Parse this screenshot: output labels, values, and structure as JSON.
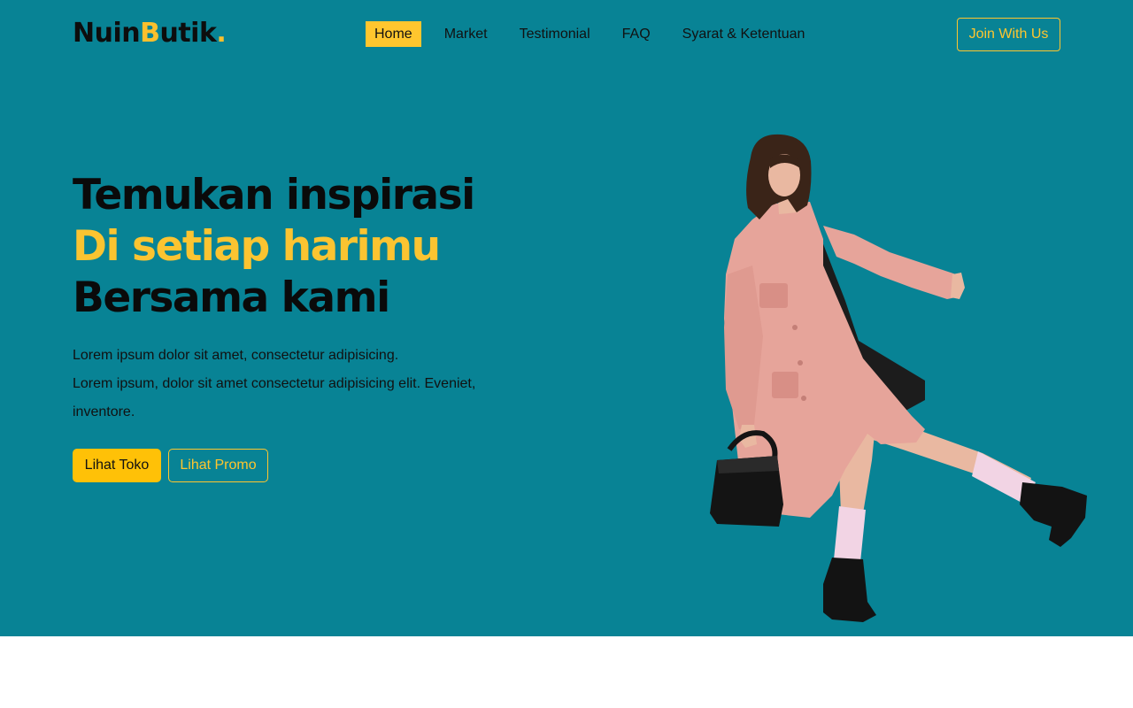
{
  "navbar": {
    "logo": {
      "part1": "Nuin",
      "part2": "B",
      "part3": "utik",
      "dot": "."
    },
    "links": [
      {
        "label": "Home",
        "active": true
      },
      {
        "label": "Market",
        "active": false
      },
      {
        "label": "Testimonial",
        "active": false
      },
      {
        "label": "FAQ",
        "active": false
      },
      {
        "label": "Syarat & Ketentuan",
        "active": false
      }
    ],
    "join_label": "Join With Us"
  },
  "hero": {
    "headline_1": "Temukan inspirasi",
    "headline_2": "Di setiap harimu",
    "headline_3": "Bersama kami",
    "desc_1": "Lorem ipsum dolor sit amet, consectetur adipisicing.",
    "desc_2": "Lorem ipsum, dolor sit amet consectetur adipisicing elit. Eveniet, inventore.",
    "primary_label": "Lihat Toko",
    "secondary_label": "Lihat Promo"
  },
  "colors": {
    "hero_bg": "#088395",
    "accent": "#ffc62e",
    "text_dark": "#0a0a0a"
  }
}
